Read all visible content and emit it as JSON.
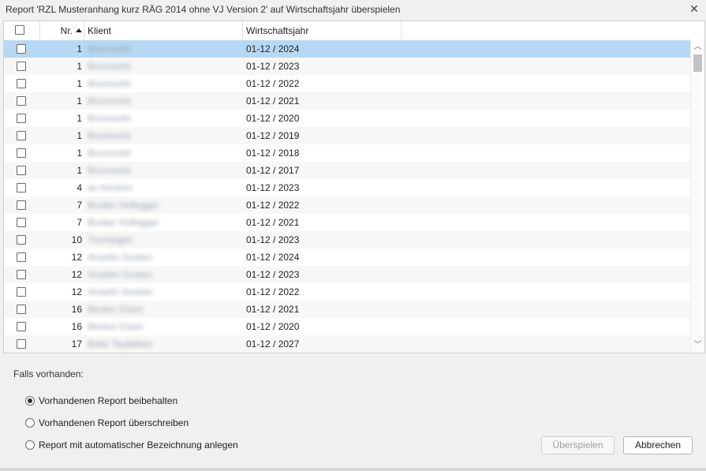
{
  "dialog": {
    "title": "Report 'RZL Musteranhang kurz RÄG 2014 ohne VJ Version 2' auf Wirtschaftsjahr überspielen",
    "close_glyph": "✕"
  },
  "grid": {
    "columns": {
      "nr": "Nr.",
      "klient": "Klient",
      "wirtschaftsjahr": "Wirtschaftsjahr"
    },
    "sort": "Nr. ascending",
    "rows": [
      {
        "nr": "1",
        "klient": "Brunnsohl",
        "wj": "01-12 / 2024",
        "selected": true
      },
      {
        "nr": "1",
        "klient": "Brunnsohl",
        "wj": "01-12 / 2023"
      },
      {
        "nr": "1",
        "klient": "Brunnsohl",
        "wj": "01-12 / 2022"
      },
      {
        "nr": "1",
        "klient": "Brunnsohl",
        "wj": "01-12 / 2021"
      },
      {
        "nr": "1",
        "klient": "Brunnsohl",
        "wj": "01-12 / 2020"
      },
      {
        "nr": "1",
        "klient": "Brunnsohl",
        "wj": "01-12 / 2019"
      },
      {
        "nr": "1",
        "klient": "Brunnsohl",
        "wj": "01-12 / 2018"
      },
      {
        "nr": "1",
        "klient": "Brunnsohl",
        "wj": "01-12 / 2017"
      },
      {
        "nr": "4",
        "klient": "an Kirchen",
        "wj": "01-12 / 2023"
      },
      {
        "nr": "7",
        "klient": "Bruder Hollegger",
        "wj": "01-12 / 2022"
      },
      {
        "nr": "7",
        "klient": "Bruder Hollegger",
        "wj": "01-12 / 2021"
      },
      {
        "nr": "10",
        "klient": "Tischlegen",
        "wj": "01-12 / 2023"
      },
      {
        "nr": "12",
        "klient": "Anselm Gosten",
        "wj": "01-12 / 2024"
      },
      {
        "nr": "12",
        "klient": "Anselm Gosten",
        "wj": "01-12 / 2023"
      },
      {
        "nr": "12",
        "klient": "Anselm Gosten",
        "wj": "01-12 / 2022"
      },
      {
        "nr": "16",
        "klient": "Becker Elsen",
        "wj": "01-12 / 2021"
      },
      {
        "nr": "16",
        "klient": "Becker Elsen",
        "wj": "01-12 / 2020"
      },
      {
        "nr": "17",
        "klient": "Bekir Taubeken",
        "wj": "01-12 / 2027"
      }
    ]
  },
  "options": {
    "heading": "Falls vorhanden:",
    "items": [
      {
        "label": "Vorhandenen Report beibehalten",
        "checked": true
      },
      {
        "label": "Vorhandenen Report überschreiben",
        "checked": false
      },
      {
        "label": "Report mit automatischer Bezeichnung anlegen",
        "checked": false
      }
    ]
  },
  "buttons": {
    "apply": "Überspielen",
    "cancel": "Abbrechen"
  },
  "colors": {
    "selection": "#b7d8f2",
    "row_alt": "#f7f7f7",
    "dialog_bg": "#f0f0f0"
  }
}
